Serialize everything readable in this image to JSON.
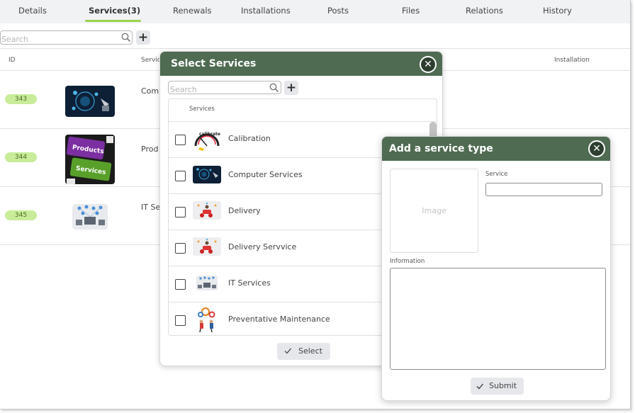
{
  "tabs": [
    {
      "label": "Details"
    },
    {
      "label": "Services(3)"
    },
    {
      "label": "Renewals"
    },
    {
      "label": "Installations"
    },
    {
      "label": "Posts"
    },
    {
      "label": "Files"
    },
    {
      "label": "Relations"
    },
    {
      "label": "History"
    }
  ],
  "main": {
    "search_placeholder": "Search",
    "columns": {
      "id": "ID",
      "service": "Servic",
      "installation": "Installation"
    },
    "rows": [
      {
        "id": "343",
        "label": "Com",
        "thumb": "computer-services-image"
      },
      {
        "id": "344",
        "label": "Prod",
        "thumb": "products-services-keyboard-image"
      },
      {
        "id": "345",
        "label": "IT Se",
        "thumb": "it-services-network-image"
      }
    ]
  },
  "select_modal": {
    "title": "Select Services",
    "search_placeholder": "Search",
    "list_header": "Services",
    "items": [
      {
        "label": "Calibration",
        "icon": "calibration-gauge-image"
      },
      {
        "label": "Computer Services",
        "icon": "computer-services-image"
      },
      {
        "label": "Delivery",
        "icon": "delivery-scooter-image"
      },
      {
        "label": "Delivery Servvice",
        "icon": "delivery-scooter-image"
      },
      {
        "label": "IT Services",
        "icon": "it-services-network-image"
      },
      {
        "label": "Preventative Maintenance",
        "icon": "maintenance-gears-image"
      }
    ],
    "select_label": "Select"
  },
  "add_modal": {
    "title": "Add a service type",
    "image_placeholder": "Image",
    "service_label": "Service",
    "information_label": "Information",
    "submit_label": "Submit"
  },
  "colors": {
    "modal_header": "#4f6b52",
    "tab_underline": "#9ad34e",
    "badge_bg": "#c8ec9a",
    "tab_bar_bg": "#f1f2f4"
  }
}
